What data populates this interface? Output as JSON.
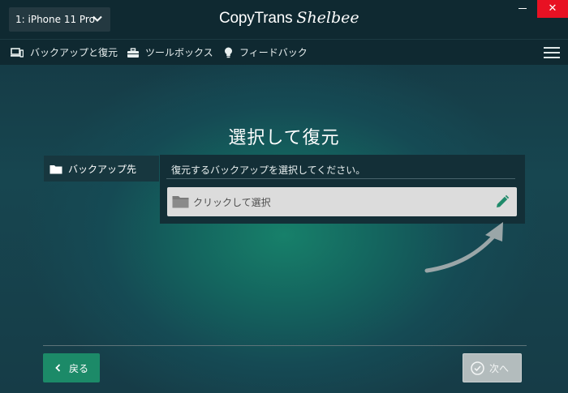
{
  "device": {
    "selected": "1: iPhone 11 Pro"
  },
  "brand": {
    "name": "CopyTrans",
    "script": "Shelbee"
  },
  "window": {
    "close_label": "✕"
  },
  "menu": {
    "items": [
      {
        "label": "バックアップと復元",
        "icon": "devices-icon"
      },
      {
        "label": "ツールボックス",
        "icon": "toolbox-icon"
      },
      {
        "label": "フィードバック",
        "icon": "lightbulb-icon"
      }
    ]
  },
  "main": {
    "title": "選択して復元",
    "side_tab": "バックアップ先",
    "instruction": "復元するバックアップを選択してください。",
    "field_label": "クリックして選択"
  },
  "footer": {
    "back_label": "戻る",
    "next_label": "次へ"
  },
  "colors": {
    "accent": "#1c8a68",
    "close_red": "#e81123",
    "pencil": "#1f8a6a"
  }
}
